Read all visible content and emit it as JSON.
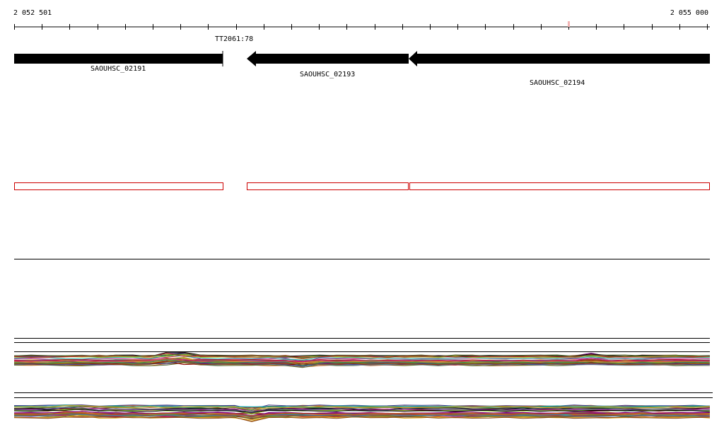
{
  "ruler": {
    "start_label": "2 052 501",
    "end_label": "2 055 000",
    "marker_label": "TT2061:78"
  },
  "genes": [
    {
      "name": "SAOUHSC_02191",
      "strand": "+"
    },
    {
      "name": "SAOUHSC_02193",
      "strand": "-"
    },
    {
      "name": "SAOUHSC_02194",
      "strand": "-"
    }
  ],
  "colors": {
    "gene": "#000000",
    "cds_outline": "#cc0000",
    "track_line": "#000000"
  }
}
